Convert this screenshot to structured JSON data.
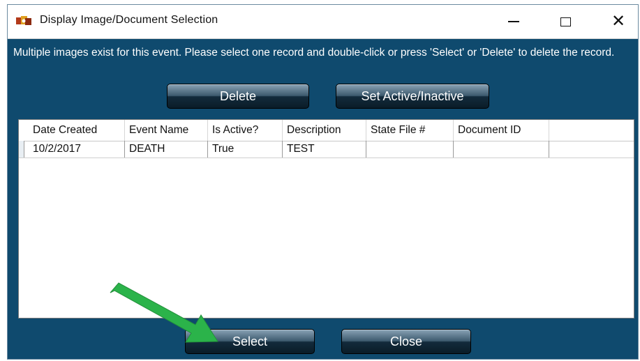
{
  "window": {
    "title": "Display Image/Document Selection",
    "min_icon": "minimize-icon",
    "max_icon": "maximize-icon",
    "close_glyph": "✕"
  },
  "instructions": "Multiple images exist for this event. Please select one record and double-click or press 'Select' or 'Delete' to delete the record.",
  "buttons": {
    "delete": "Delete",
    "set_active": "Set Active/Inactive",
    "select": "Select",
    "close": "Close"
  },
  "grid": {
    "columns": [
      "Date Created",
      "Event Name",
      "Is Active?",
      "Description",
      "State File #",
      "Document ID",
      ""
    ],
    "rows": [
      [
        "10/2/2017",
        "DEATH",
        "True",
        "TEST",
        "",
        "",
        ""
      ]
    ]
  },
  "colors": {
    "window_bg": "#0f4a6e",
    "arrow": "#2bb34a"
  }
}
